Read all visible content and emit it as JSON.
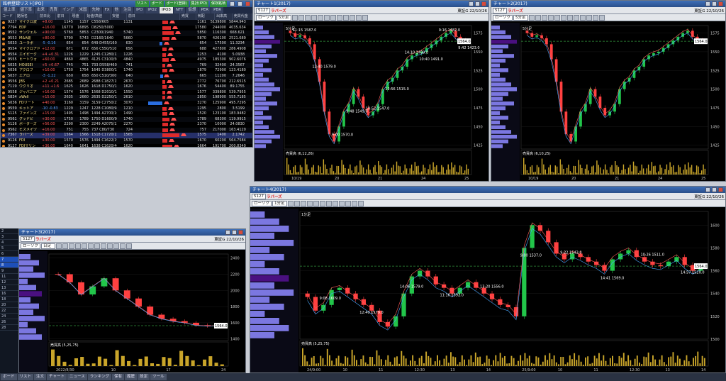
{
  "list_window": {
    "title": "銘柄登録リスト[IPO]",
    "title_buttons": [
      "リスト",
      "ボード",
      "ボード(登録)",
      "集計(IPO)",
      "保存銘柄"
    ],
    "tabs": [
      "値上率",
      "値下率",
      "出来",
      "売買",
      "インデ",
      "米国",
      "先物",
      "FX",
      "他",
      "注目",
      "IPO",
      "IPO2",
      "IPO3",
      "NFT",
      "仮想",
      "PER",
      "PBR"
    ],
    "active_tab": "IPO3",
    "headers": [
      "コード",
      "銘柄名",
      "前日比",
      "前日",
      "現値",
      "始値/高値",
      "安値",
      "前日",
      "売買",
      "気配",
      "出来高",
      "売買代金"
    ],
    "rows": [
      {
        "code": "9227",
        "name": "マイクロ波",
        "chg": "+8.00",
        "v1": "1145",
        "v2": "1157",
        "rng": "C558/605",
        "v3": "1131",
        "bar": 0.1,
        "dir": "up",
        "v4": "1161",
        "v5": "5139800",
        "v6": "5844.9434"
      },
      {
        "code": "7794",
        "name": "EDP",
        "chg": "+16.00",
        "v1": "16770",
        "v2": "16895",
        "rng": "D8250/5000",
        "v3": "",
        "bar": 0.15,
        "dir": "up",
        "v4": "17580",
        "v5": "244000",
        "v6": "4035.6346"
      },
      {
        "code": "9552",
        "name": "サンウェル",
        "chg": "+90.00",
        "v1": "5760",
        "v2": "5853",
        "rng": "C2300/1940",
        "v3": "5740",
        "bar": 0.2,
        "dir": "up",
        "v4": "5850",
        "v5": "116300",
        "v6": "668.621"
      },
      {
        "code": "9553",
        "name": "M&A総",
        "chg": "+80.00",
        "v1": "5790",
        "v2": "5743",
        "rng": "D2160/1640",
        "v3": "5660",
        "bar": 0.12,
        "dir": "up",
        "v4": "5870",
        "v5": "426100",
        "v6": "2521.689"
      },
      {
        "code": "5033",
        "name": "ユーラボ",
        "chg": "-5 -0.16",
        "v1": "654",
        "v2": "654",
        "rng": "649 D455/1600",
        "v3": "630",
        "bar": 0.05,
        "dir": "down",
        "v4": "654",
        "v5": "17500",
        "v6": "11.3234"
      },
      {
        "code": "9554",
        "name": "マイクロアド",
        "chg": "+12.00",
        "v1": "671",
        "v2": "672",
        "rng": "656 C550/510",
        "v3": "656",
        "bar": 0.08,
        "dir": "up",
        "v4": "688",
        "v5": "427800",
        "v6": "286.4908"
      },
      {
        "code": "9554",
        "name": "エイピーク",
        "chg": "+4 +0.31",
        "v1": "1226",
        "v2": "1229",
        "rng": "1245 C1280/1200",
        "v3": "1226",
        "bar": 0.06,
        "dir": "up",
        "v4": "1253",
        "v5": "4100",
        "v6": "5.0938"
      },
      {
        "code": "9555",
        "name": "ヒートウォ",
        "chg": "+60.00",
        "v1": "4860",
        "v2": "4865",
        "rng": "4125 C3100/5600",
        "v3": "4840",
        "bar": 0.11,
        "dir": "up",
        "v4": "4975",
        "v5": "185300",
        "v6": "902.6076"
      },
      {
        "code": "5035",
        "name": "HOUSEI",
        "chg": "+5 +0.67",
        "v1": "745",
        "v2": "751",
        "rng": "733 D558/460",
        "v3": "741",
        "bar": 0.05,
        "dir": "up",
        "v4": "769",
        "v5": "32400",
        "v6": "24.3567"
      },
      {
        "code": "5036",
        "name": "アクロフ",
        "chg": "+10.00",
        "v1": "1750",
        "v2": "1754",
        "rng": "1645 D3800/1290",
        "v3": "1740",
        "bar": 0.09,
        "dir": "up",
        "v4": "1879",
        "v5": "72900",
        "v6": "123.4180"
      },
      {
        "code": "5037",
        "name": "エアロ",
        "chg": "-3 -1.22",
        "v1": "650",
        "v2": "658",
        "rng": "650 C510/300",
        "v3": "640",
        "bar": 0.04,
        "dir": "down",
        "v4": "665",
        "v5": "11200",
        "v6": "7.2646"
      },
      {
        "code": "9556",
        "name": "JBS",
        "chg": "+2 +0.21",
        "v1": "2685",
        "v2": "2689",
        "rng": "2688 C1827/1520",
        "v3": "2670",
        "bar": 0.05,
        "dir": "up",
        "v4": "2772",
        "v5": "76700",
        "v6": "212.6515"
      },
      {
        "code": "7119",
        "name": "ウクリオ",
        "chg": "+11 +1.67",
        "v1": "1625",
        "v2": "1626",
        "rng": "1618 D1750/1460",
        "v3": "1620",
        "bar": 0.08,
        "dir": "up",
        "v4": "1676",
        "v5": "54400",
        "v6": "89.1755"
      },
      {
        "code": "9558",
        "name": "ジャパニア",
        "chg": "+16.00",
        "v1": "1574",
        "v2": "1576",
        "rng": "1568 D2010/1970",
        "v3": "1550",
        "bar": 0.05,
        "dir": "up",
        "v4": "1577",
        "v5": "339800",
        "v6": "539.7955"
      },
      {
        "code": "5834",
        "name": "xWell",
        "chg": "+15.00",
        "v1": "2635",
        "v2": "2660",
        "rng": "2635 D2250/1800",
        "v3": "2610",
        "bar": 0.05,
        "dir": "up",
        "v4": "2850",
        "v5": "198900",
        "v6": "555.7185"
      },
      {
        "code": "5036",
        "name": "FDリート",
        "chg": "+40.00",
        "v1": "3160",
        "v2": "3159",
        "rng": "3159 C2750/2500",
        "v3": "3070",
        "bar": 0.25,
        "dir": "down",
        "v4": "3270",
        "v5": "125900",
        "v6": "495.7295"
      },
      {
        "code": "9559",
        "name": "キットア",
        "chg": "-10 -0.83",
        "v1": "1229",
        "v2": "1247",
        "rng": "1228 C1080/980",
        "v3": "1210",
        "bar": 0.07,
        "dir": "up",
        "v4": "1295",
        "v5": "2800",
        "v6": "3.5199"
      },
      {
        "code": "5125",
        "name": "ファインズ",
        "chg": "+15.00",
        "v1": "1495",
        "v2": "1498",
        "rng": "1494 A2700/1690",
        "v3": "1490",
        "bar": 0.09,
        "dir": "up",
        "v4": "1520",
        "v5": "123100",
        "v6": "183.9482"
      },
      {
        "code": "9561",
        "name": "グッドビ",
        "chg": "+30.00",
        "v1": "1750",
        "v2": "1789",
        "rng": "1750 D1600/910",
        "v3": "1740",
        "bar": 0.12,
        "dir": "up",
        "v4": "1789",
        "v5": "68300",
        "v6": "119.9915"
      },
      {
        "code": "5126",
        "name": "ポーターズ",
        "chg": "+56.00",
        "v1": "2290",
        "v2": "2300",
        "rng": "2249 A2075/1570",
        "v3": "2270",
        "bar": 0.1,
        "dir": "up",
        "v4": "2370",
        "v5": "10000",
        "v6": "24.0830"
      },
      {
        "code": "9562",
        "name": "ビズメイツ",
        "chg": "+16.00",
        "v1": "751",
        "v2": "755",
        "rng": "737 C80/730",
        "v3": "724",
        "bar": 0.1,
        "dir": "up",
        "v4": "757",
        "v5": "217000",
        "v6": "163.4120"
      },
      {
        "code": "7367",
        "name": "ラバーズ",
        "chg": "+39.00",
        "v1": "1564",
        "v2": "1566",
        "rng": "1518 C1720/1570",
        "v3": "1565",
        "bar": 0.3,
        "dir": "up",
        "v4": "1575",
        "v5": "1400",
        "v6": "2.1742",
        "hl": true
      },
      {
        "code": "9126",
        "name": "FDI",
        "chg": "+30.00",
        "v1": "1570",
        "v2": "1576",
        "rng": "1494 C1622/1940",
        "v3": "1570",
        "bar": 0.09,
        "dir": "up",
        "v4": "1670",
        "v5": "60200",
        "v6": "564.7584"
      },
      {
        "code": "9127",
        "name": "FDIマリン",
        "chg": "+36.00",
        "v1": "1640",
        "v2": "1641",
        "rng": "1638 C1620/4480",
        "v3": "1620",
        "bar": 0.18,
        "dir": "up",
        "v4": "1664",
        "v5": "191700",
        "v6": "200.8340"
      },
      {
        "code": "5129",
        "name": "ソシオネクスト",
        "chg": "+260.00",
        "v1": "4760",
        "v2": "4775",
        "rng": "4750 D3650/3450",
        "v3": "4725",
        "bar": 0.2,
        "dir": "up",
        "v4": "5000",
        "v5": "2094900",
        "v6": "10021.654"
      },
      {
        "code": "9563",
        "name": "エムケーエル",
        "chg": "-15 -0.43",
        "v1": "3470",
        "v2": "3475",
        "rng": "3470 D3950/3650",
        "v3": "3420",
        "bar": 0.06,
        "dir": "down",
        "v4": "3485",
        "v5": "81700",
        "v6": "2911.2470"
      },
      {
        "code": "9562",
        "name": "ビラコー",
        "chg": "+185 +2.55",
        "v1": "2680",
        "v2": "2681",
        "rng": "2654 A4195/3970",
        "v3": "2631",
        "bar": 0.15,
        "dir": "up",
        "v4": "2810",
        "v5": "263600",
        "v6": "744.3830"
      }
    ]
  },
  "chart_top_left": {
    "title": "チャート1(2017)",
    "code": "5127",
    "symbol_tag": "ラバーズ",
    "market": "東証G 22/10/26",
    "chart_style": "ローソク",
    "interval": "5分足",
    "period_label": "5分足",
    "volume_label": "売買高 (6,12,26)",
    "x_ticks": [
      "10/19",
      "20",
      "21",
      "24",
      "25"
    ],
    "y_ticks": [
      "1575",
      "1550",
      "1525",
      "1500",
      "1475",
      "1450",
      "1425"
    ],
    "last_price": "1564.0",
    "annotations": [
      "11:15 1587.0",
      "12:40 1579.0",
      "9:00 1570.0",
      "9:48 1549.0",
      "10:52 1547.0",
      "12:56 1515.0",
      "14:10 1499.0",
      "10:40 1491.0",
      "9:16 1482.0",
      "9:42 1423.0"
    ],
    "chart_data": {
      "type": "candlestick",
      "xlabel": "",
      "ylabel": "",
      "ylim": [
        1420,
        1585
      ],
      "close": [
        1575,
        1570,
        1572,
        1568,
        1560,
        1540,
        1510,
        1470,
        1440,
        1430,
        1450,
        1470,
        1480,
        1500,
        1490,
        1475,
        1465,
        1470,
        1480,
        1500,
        1510,
        1515,
        1525,
        1530,
        1540,
        1545,
        1548,
        1550,
        1555,
        1560,
        1565,
        1570,
        1575,
        1578,
        1570,
        1565,
        1564
      ]
    }
  },
  "chart_top_right": {
    "title": "チャート2(2017)",
    "code": "5127",
    "symbol_tag": "ラバーズ",
    "market": "東証G 22/10/26",
    "chart_style": "ローソク",
    "interval": "5分足",
    "period_label": "5分足",
    "volume_label": "売買高 (6,10,25)",
    "x_ticks": [
      "10/19",
      "20",
      "21",
      "24",
      "25"
    ],
    "y_ticks": [
      "1575",
      "1550",
      "1525",
      "1500",
      "1475",
      "1450",
      "1425"
    ],
    "last_price": "1564.0",
    "chart_data": {
      "type": "candlestick",
      "xlabel": "",
      "ylabel": "",
      "ylim": [
        1420,
        1585
      ],
      "close": [
        1575,
        1570,
        1572,
        1568,
        1560,
        1540,
        1510,
        1470,
        1440,
        1430,
        1450,
        1470,
        1480,
        1500,
        1490,
        1475,
        1465,
        1470,
        1480,
        1500,
        1510,
        1515,
        1525,
        1530,
        1540,
        1545,
        1548,
        1550,
        1555,
        1560,
        1565,
        1570,
        1575,
        1578,
        1570,
        1565,
        1564
      ]
    }
  },
  "chart_bottom_left": {
    "title": "チャート3(2017)",
    "code": "5127",
    "symbol_tag": "ラバーズ",
    "market": "東証G 22/10/26",
    "chart_style": "ローソク",
    "interval": "日足",
    "volume_label": "売買高 (5,25,75)",
    "x_ticks": [
      "2022/8/30",
      "10",
      "17",
      "24"
    ],
    "y_ticks": [
      "2400",
      "2200",
      "2000",
      "1800",
      "1600",
      "1400"
    ],
    "last_price": "1564.0",
    "chart_data": {
      "type": "candlestick",
      "xlabel": "",
      "ylabel": "",
      "ylim": [
        1380,
        2450
      ],
      "close": [
        2200,
        2100,
        1950,
        2050,
        2150,
        2000,
        1900,
        1800,
        1700,
        1650,
        1620,
        1600,
        1570,
        1560,
        1564
      ]
    }
  },
  "chart_bottom_right": {
    "title": "チャート4(2017)",
    "code": "5127",
    "symbol_tag": "ラバーズ",
    "market": "東証G 22/10/26",
    "chart_style": "ローソク",
    "interval": "1分足",
    "period_label": "1分足",
    "volume_label": "売買高 (5,25,75)",
    "x_ticks": [
      "24/9:00",
      "10",
      "11",
      "12:30",
      "13",
      "14",
      "25/9:00",
      "10",
      "11",
      "12:30",
      "13",
      "14"
    ],
    "y_ticks": [
      "1600",
      "1580",
      "1560",
      "1540",
      "1520",
      "1500"
    ],
    "last_price": "1564.0",
    "annotations": [
      "9:08 1609.0",
      "12:40 1579.0",
      "14:06 1579.0",
      "11:16 1592.0",
      "13:20 1556.0",
      "9:00 1537.0",
      "9:22 1543.0",
      "14:41 1569.0",
      "10:26 1511.0",
      "14:57 1520.0"
    ],
    "chart_data": {
      "type": "candlestick",
      "xlabel": "",
      "ylabel": "",
      "ylim": [
        1500,
        1612
      ],
      "close": [
        1537,
        1525,
        1530,
        1543,
        1545,
        1540,
        1535,
        1530,
        1525,
        1515,
        1511,
        1520,
        1540,
        1555,
        1560,
        1555,
        1548,
        1545,
        1540,
        1545,
        1550,
        1545,
        1540,
        1535,
        1530,
        1528,
        1520,
        1580,
        1600,
        1595,
        1585,
        1575,
        1570,
        1575,
        1572,
        1568,
        1565,
        1560,
        1570,
        1575,
        1578,
        1572,
        1568,
        1565,
        1564,
        1568,
        1572,
        1565,
        1560,
        1564
      ]
    }
  },
  "side_strip": {
    "cells": [
      "2",
      "3",
      "4",
      "5",
      "6",
      "7",
      "8",
      "9",
      "11",
      "12",
      "13",
      "16",
      "18",
      "20",
      "22",
      "24",
      "26",
      "28"
    ]
  },
  "taskbar": {
    "items": [
      "ボード",
      "リスト",
      "注文",
      "チャート",
      "ニュース",
      "ランキング",
      "保有",
      "履歴",
      "設定",
      "ツール"
    ]
  },
  "colors": {
    "up": "#ff4040",
    "down": "#22c64a",
    "accent": "#e02020",
    "volume_bar": "#c9a52a",
    "profile_bar": "#7b77e0"
  }
}
